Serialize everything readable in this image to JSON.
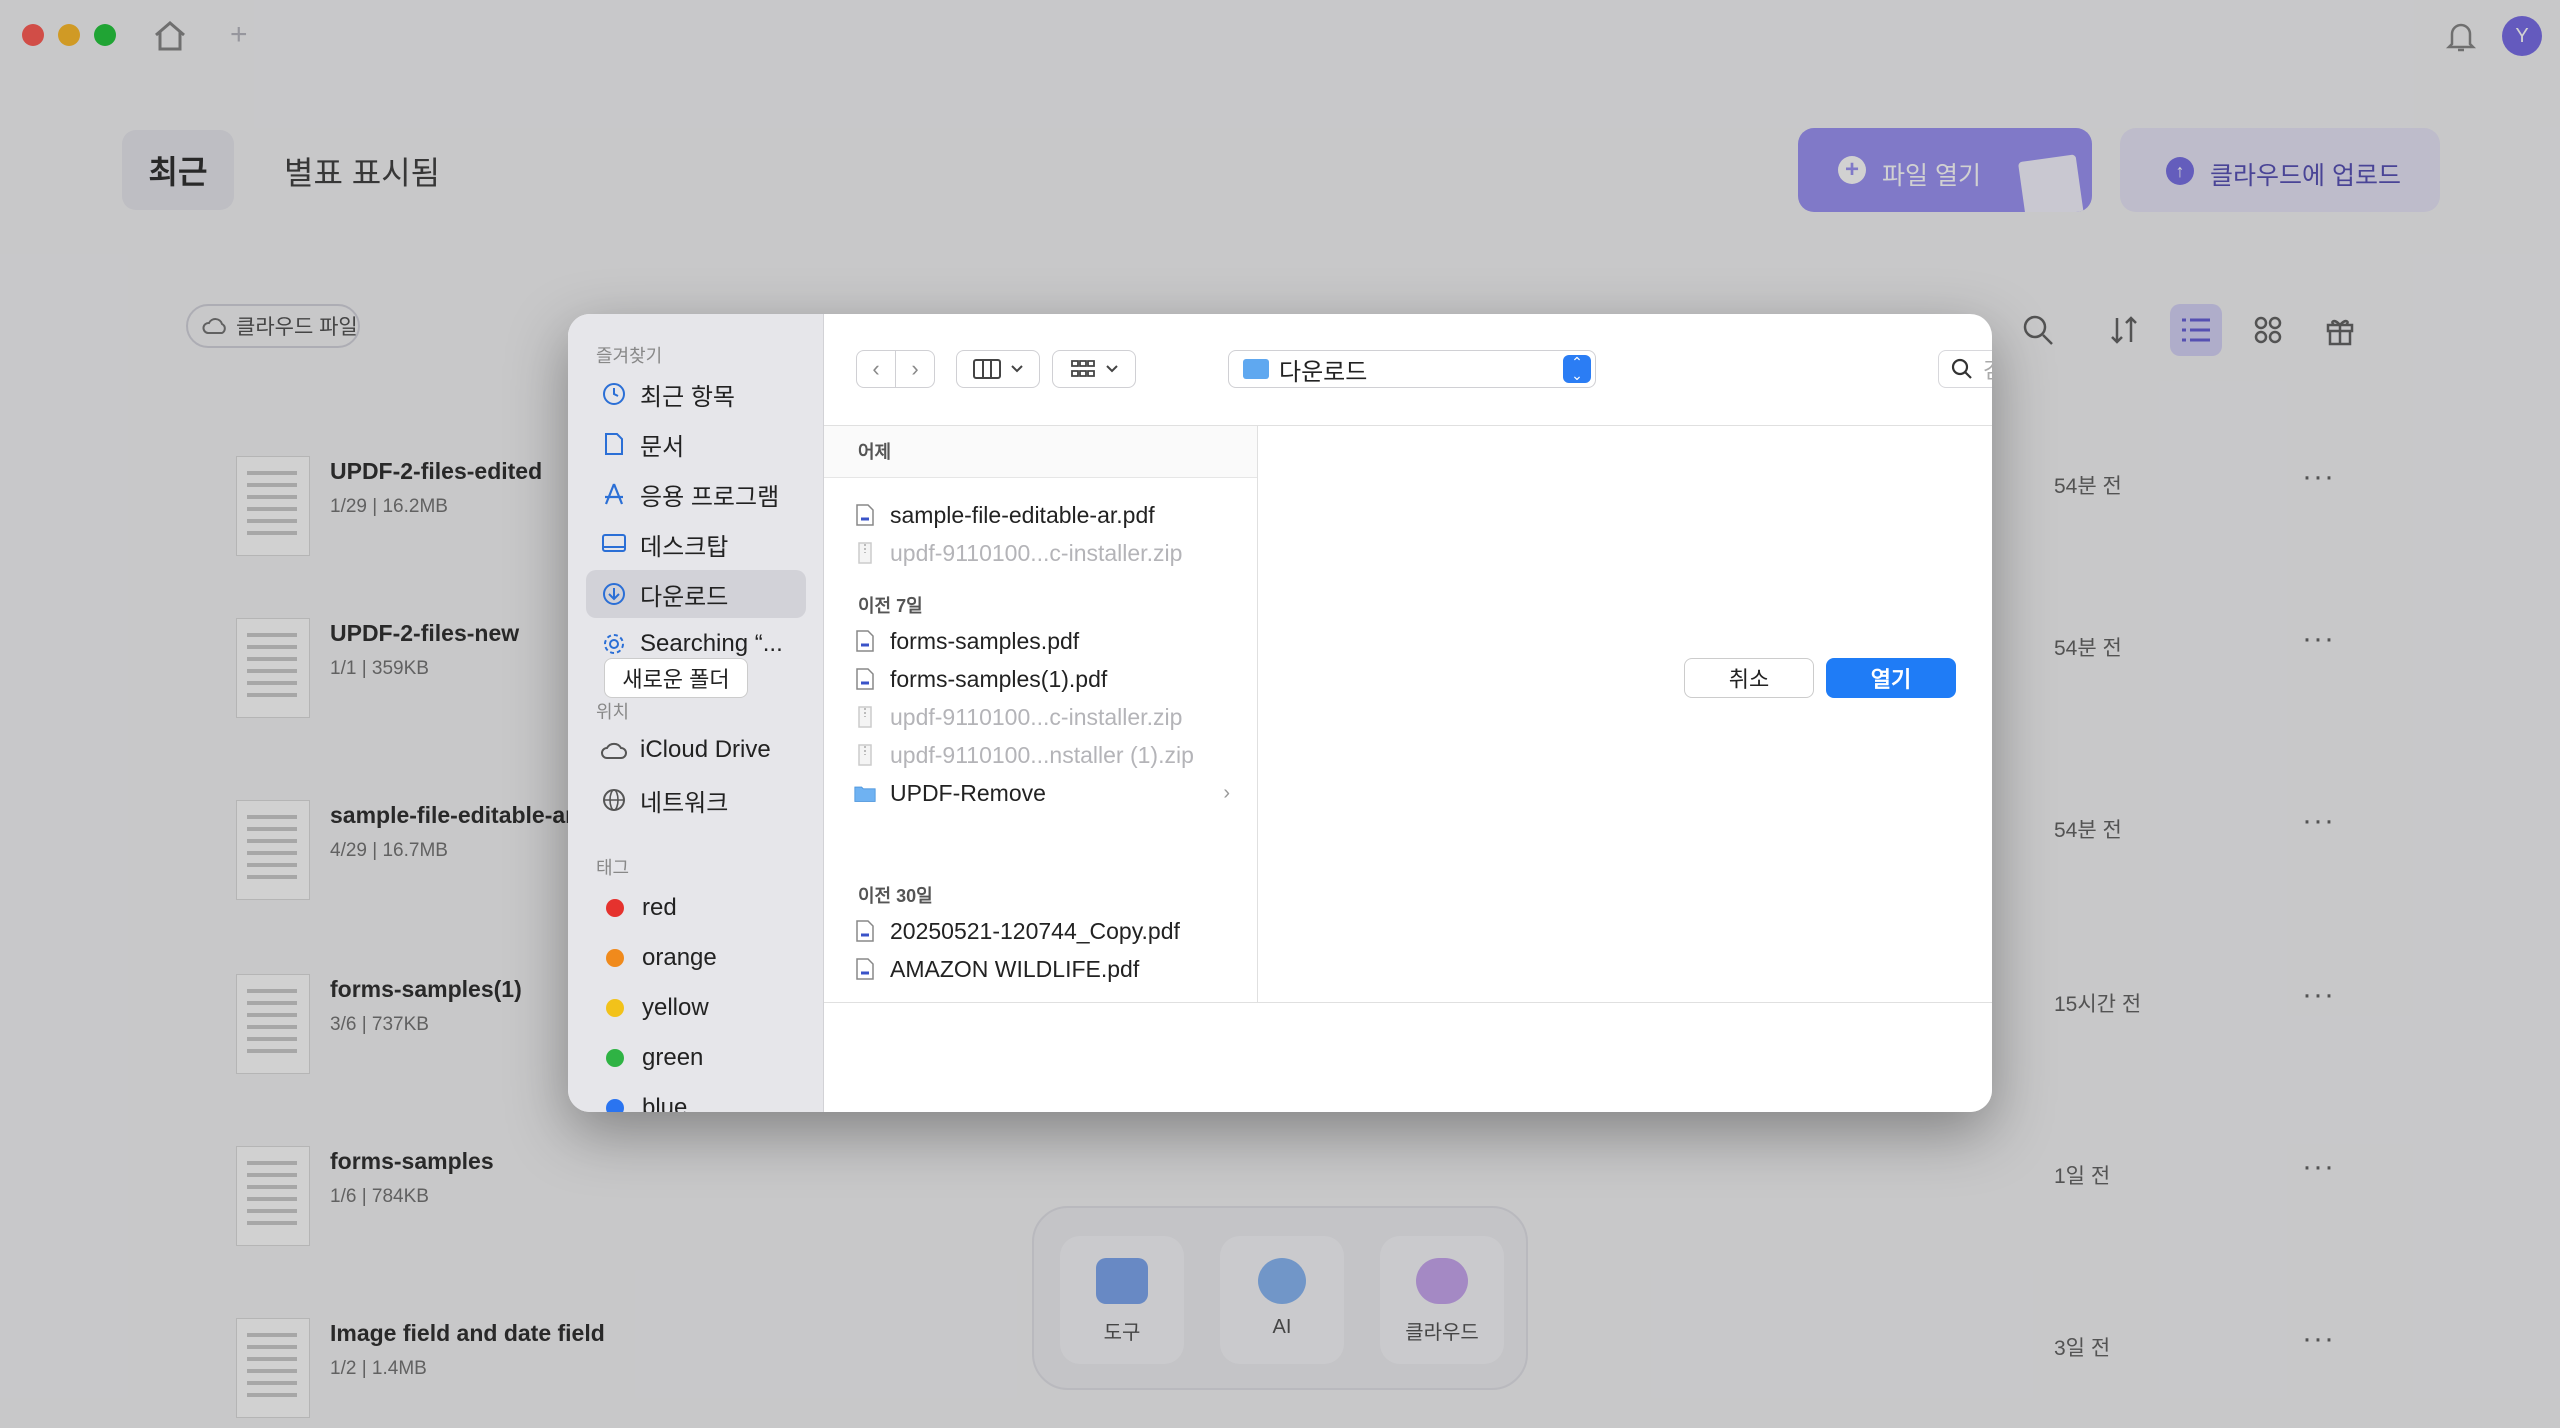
{
  "app": {
    "tabs": {
      "recent": "최근",
      "starred": "별표 표시됨"
    },
    "buttons": {
      "open_file": "파일 열기",
      "upload_cloud": "클라우드에 업로드"
    },
    "cloud_filter": "클라우드 파일",
    "avatar_initial": "Y",
    "files": [
      {
        "name": "UPDF-2-files-edited",
        "meta": "1/29 | 16.2MB",
        "time": "54분 전"
      },
      {
        "name": "UPDF-2-files-new",
        "meta": "1/1 | 359KB",
        "time": "54분 전"
      },
      {
        "name": "sample-file-editable-ar",
        "meta": "4/29 | 16.7MB",
        "time": "54분 전"
      },
      {
        "name": "forms-samples(1)",
        "meta": "3/6 | 737KB",
        "time": "15시간 전"
      },
      {
        "name": "forms-samples",
        "meta": "1/6 | 784KB",
        "time": "1일 전"
      },
      {
        "name": "Image field and date field",
        "meta": "1/2 | 1.4MB",
        "time": "3일 전"
      }
    ],
    "more_glyph": "···",
    "dock": [
      {
        "label": "도구"
      },
      {
        "label": "AI"
      },
      {
        "label": "클라우드"
      }
    ]
  },
  "dialog": {
    "sidebar": {
      "favorites_title": "즐겨찾기",
      "favorites": [
        {
          "label": "최근 항목",
          "icon": "clock-icon"
        },
        {
          "label": "문서",
          "icon": "document-icon"
        },
        {
          "label": "응용 프로그램",
          "icon": "apps-icon"
        },
        {
          "label": "데스크탑",
          "icon": "desktop-icon"
        },
        {
          "label": "다운로드",
          "icon": "download-icon",
          "active": true
        },
        {
          "label": "Searching “...",
          "icon": "gear-icon"
        }
      ],
      "locations_title": "위치",
      "locations": [
        {
          "label": "iCloud Drive",
          "icon": "cloud-icon"
        },
        {
          "label": "네트워크",
          "icon": "globe-icon"
        }
      ],
      "tags_title": "태그",
      "tags": [
        {
          "label": "red",
          "color": "#e5322e"
        },
        {
          "label": "orange",
          "color": "#f08a1c"
        },
        {
          "label": "yellow",
          "color": "#f2c21a"
        },
        {
          "label": "green",
          "color": "#2fb344"
        },
        {
          "label": "blue",
          "color": "#2a74f0"
        }
      ]
    },
    "toolbar": {
      "location": "다운로드",
      "search_placeholder": "검색"
    },
    "groups": [
      {
        "title": "어제",
        "files": [
          {
            "name": "sample-file-editable-ar.pdf",
            "type": "pdf",
            "enabled": true
          },
          {
            "name": "updf-9110100...c-installer.zip",
            "type": "zip",
            "enabled": false
          }
        ]
      },
      {
        "title": "이전 7일",
        "files": [
          {
            "name": "forms-samples.pdf",
            "type": "pdf",
            "enabled": true
          },
          {
            "name": "forms-samples(1).pdf",
            "type": "pdf",
            "enabled": true
          },
          {
            "name": "updf-9110100...c-installer.zip",
            "type": "zip",
            "enabled": false
          },
          {
            "name": "updf-9110100...nstaller (1).zip",
            "type": "zip",
            "enabled": false
          },
          {
            "name": "UPDF-Remove",
            "type": "folder",
            "enabled": true
          }
        ]
      },
      {
        "title": "이전 30일",
        "files": [
          {
            "name": "20250521-120744_Copy.pdf",
            "type": "pdf",
            "enabled": true
          },
          {
            "name": "AMAZON WILDLIFE.pdf",
            "type": "pdf",
            "enabled": true
          }
        ]
      }
    ],
    "footer": {
      "new_folder": "새로운 폴더",
      "cancel": "취소",
      "open": "열기"
    }
  }
}
